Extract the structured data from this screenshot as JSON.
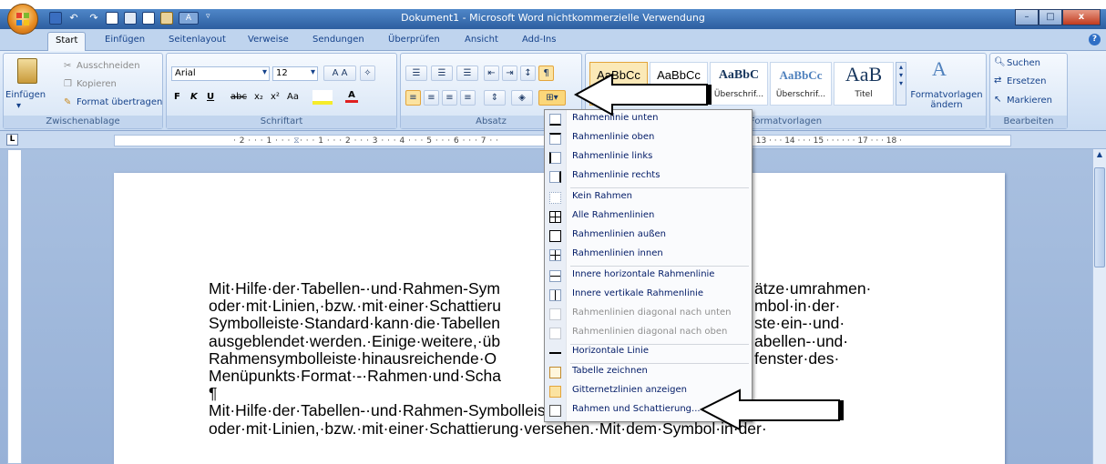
{
  "window": {
    "title": "Dokument1 - Microsoft Word nichtkommerzielle Verwendung",
    "buttons": {
      "minimize": "–",
      "restore": "□",
      "close": "x"
    }
  },
  "tabs": [
    "Start",
    "Einfügen",
    "Seitenlayout",
    "Verweise",
    "Sendungen",
    "Überprüfen",
    "Ansicht",
    "Add-Ins"
  ],
  "ribbon": {
    "clipboard": {
      "label": "Zwischenablage",
      "paste": "Einfügen",
      "cut": "Ausschneiden",
      "copy": "Kopieren",
      "format_painter": "Format übertragen"
    },
    "font": {
      "label": "Schriftart",
      "font_name": "Arial",
      "font_size": "12"
    },
    "paragraph": {
      "label": "Absatz"
    },
    "styles": {
      "label": "Formatvorlagen",
      "items": [
        {
          "preview": "AaBbCc",
          "name": ""
        },
        {
          "preview": "AaBbCc",
          "name": ""
        },
        {
          "preview": "AaBbC",
          "name": "Überschrif..."
        },
        {
          "preview": "AaBbCc",
          "name": "Überschrif..."
        },
        {
          "preview": "AaB",
          "name": "Titel"
        }
      ],
      "change_styles": "Formatvorlagen ändern"
    },
    "editing": {
      "label": "Bearbeiten",
      "find": "Suchen",
      "replace": "Ersetzen",
      "select": "Markieren"
    }
  },
  "ruler": {
    "left_text": "· 2 · · · 1 · · · ",
    "main_text": "· · · 1 · · · 2 · · · 3 · · · 4 · · · 5 · · · 6 · · · 7 · ·",
    "right_text": "· 13 · · · 14 · · · 15 · · ·   · · · 17 · · · 18 ·"
  },
  "document": {
    "lines": [
      "Mit·Hilfe·der·Tabellen-·und·Rahmen-Sym",
      "oder·mit·Linien,·bzw.·mit·einer·Schattieru",
      "Symbolleiste·Standard·kann·die·Tabellen",
      "ausgeblendet·werden.·Einige·weitere,·üb",
      "Rahmensymbolleiste·hinausreichende·O",
      "Menüpunkts·Format·-·Rahmen·und·Scha",
      "¶",
      "Mit·Hilfe·der·Tabellen-·und·Rahmen-Symbolleiste·können·sie·Absätze·umrahmen·",
      "oder·mit·Linien,·bzw.·mit·einer·Schattierung·versehen.·Mit·dem·Symbol·in·der·"
    ],
    "right_fragments": [
      "ätze·umrahmen·",
      "mbol·in·der·",
      "ste·ein-·und·",
      "abellen-·und·",
      "fenster·des·"
    ]
  },
  "menu": {
    "items": [
      {
        "label": "Rahmenlinie unten",
        "icon": "border-bottom-icon",
        "disabled": false
      },
      {
        "label": "Rahmenlinie oben",
        "icon": "border-top-icon",
        "disabled": false
      },
      {
        "label": "Rahmenlinie links",
        "icon": "border-left-icon",
        "disabled": false
      },
      {
        "label": "Rahmenlinie rechts",
        "icon": "border-right-icon",
        "disabled": false
      },
      {
        "label": "Kein Rahmen",
        "icon": "no-border-icon",
        "disabled": false
      },
      {
        "label": "Alle Rahmenlinien",
        "icon": "all-borders-icon",
        "disabled": false
      },
      {
        "label": "Rahmenlinien außen",
        "icon": "outside-borders-icon",
        "disabled": false
      },
      {
        "label": "Rahmenlinien innen",
        "icon": "inside-borders-icon",
        "disabled": false
      },
      {
        "label": "Innere horizontale Rahmenlinie",
        "icon": "inside-horizontal-border-icon",
        "disabled": false
      },
      {
        "label": "Innere vertikale Rahmenlinie",
        "icon": "inside-vertical-border-icon",
        "disabled": false
      },
      {
        "label": "Rahmenlinien diagonal nach unten",
        "icon": "diagonal-down-border-icon",
        "disabled": true
      },
      {
        "label": "Rahmenlinien diagonal nach oben",
        "icon": "diagonal-up-border-icon",
        "disabled": true
      },
      {
        "label": "Horizontale Linie",
        "icon": "horizontal-line-icon",
        "disabled": false
      },
      {
        "label": "Tabelle zeichnen",
        "icon": "draw-table-icon",
        "disabled": false
      },
      {
        "label": "Gitternetzlinien anzeigen",
        "icon": "gridlines-icon",
        "disabled": false
      },
      {
        "label": "Rahmen und Schattierung...",
        "icon": "borders-shading-icon",
        "disabled": false
      }
    ]
  },
  "colors": {
    "ribbon_blue": "#c9dbf2",
    "title_blue": "#2d5e9f",
    "workspace_blue": "#a9c0e0"
  }
}
